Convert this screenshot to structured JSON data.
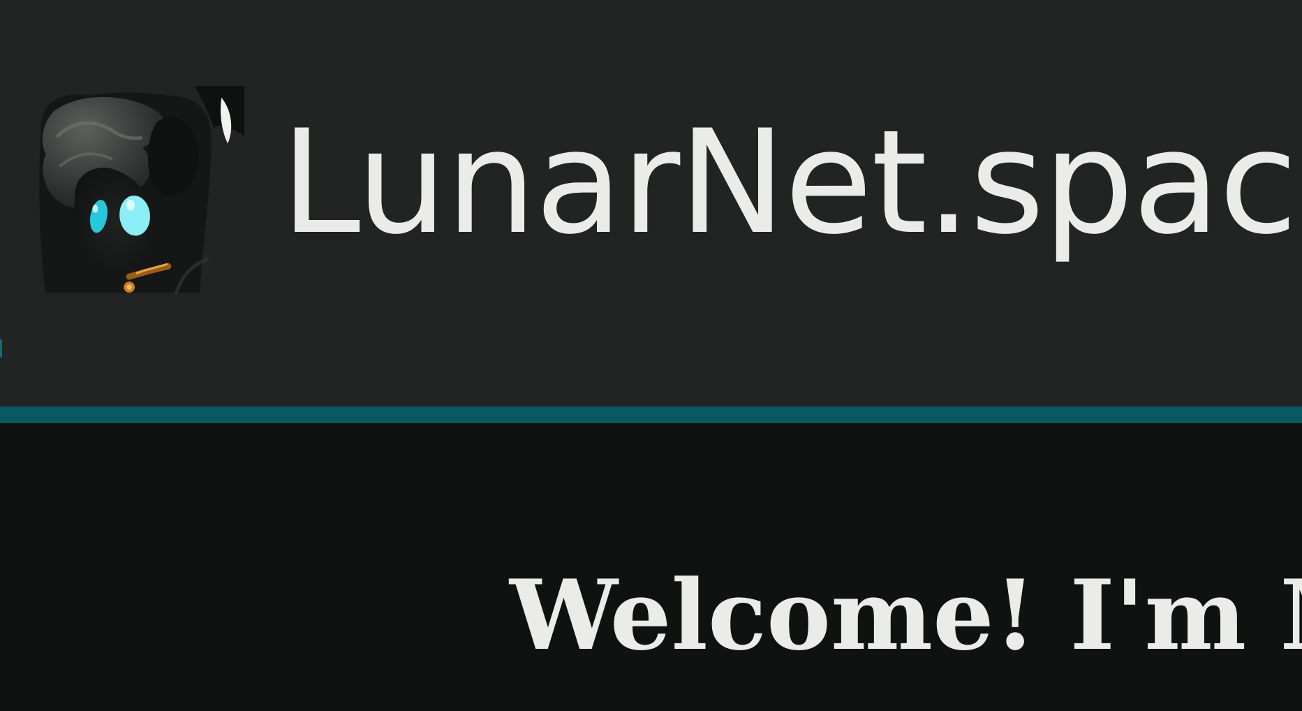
{
  "header": {
    "site_title": "LunarNet.space",
    "logo_alt": "Moon pony avatar",
    "colors": {
      "header_background": "#212423",
      "accent_bar": "#0b5862",
      "title_text": "#ebecea"
    }
  },
  "main": {
    "welcome_heading": "Welcome! I'm M",
    "colors": {
      "background": "#0f1211",
      "heading_text": "#ebecea"
    }
  },
  "icons": {
    "logo": "pony-avatar-logo"
  }
}
